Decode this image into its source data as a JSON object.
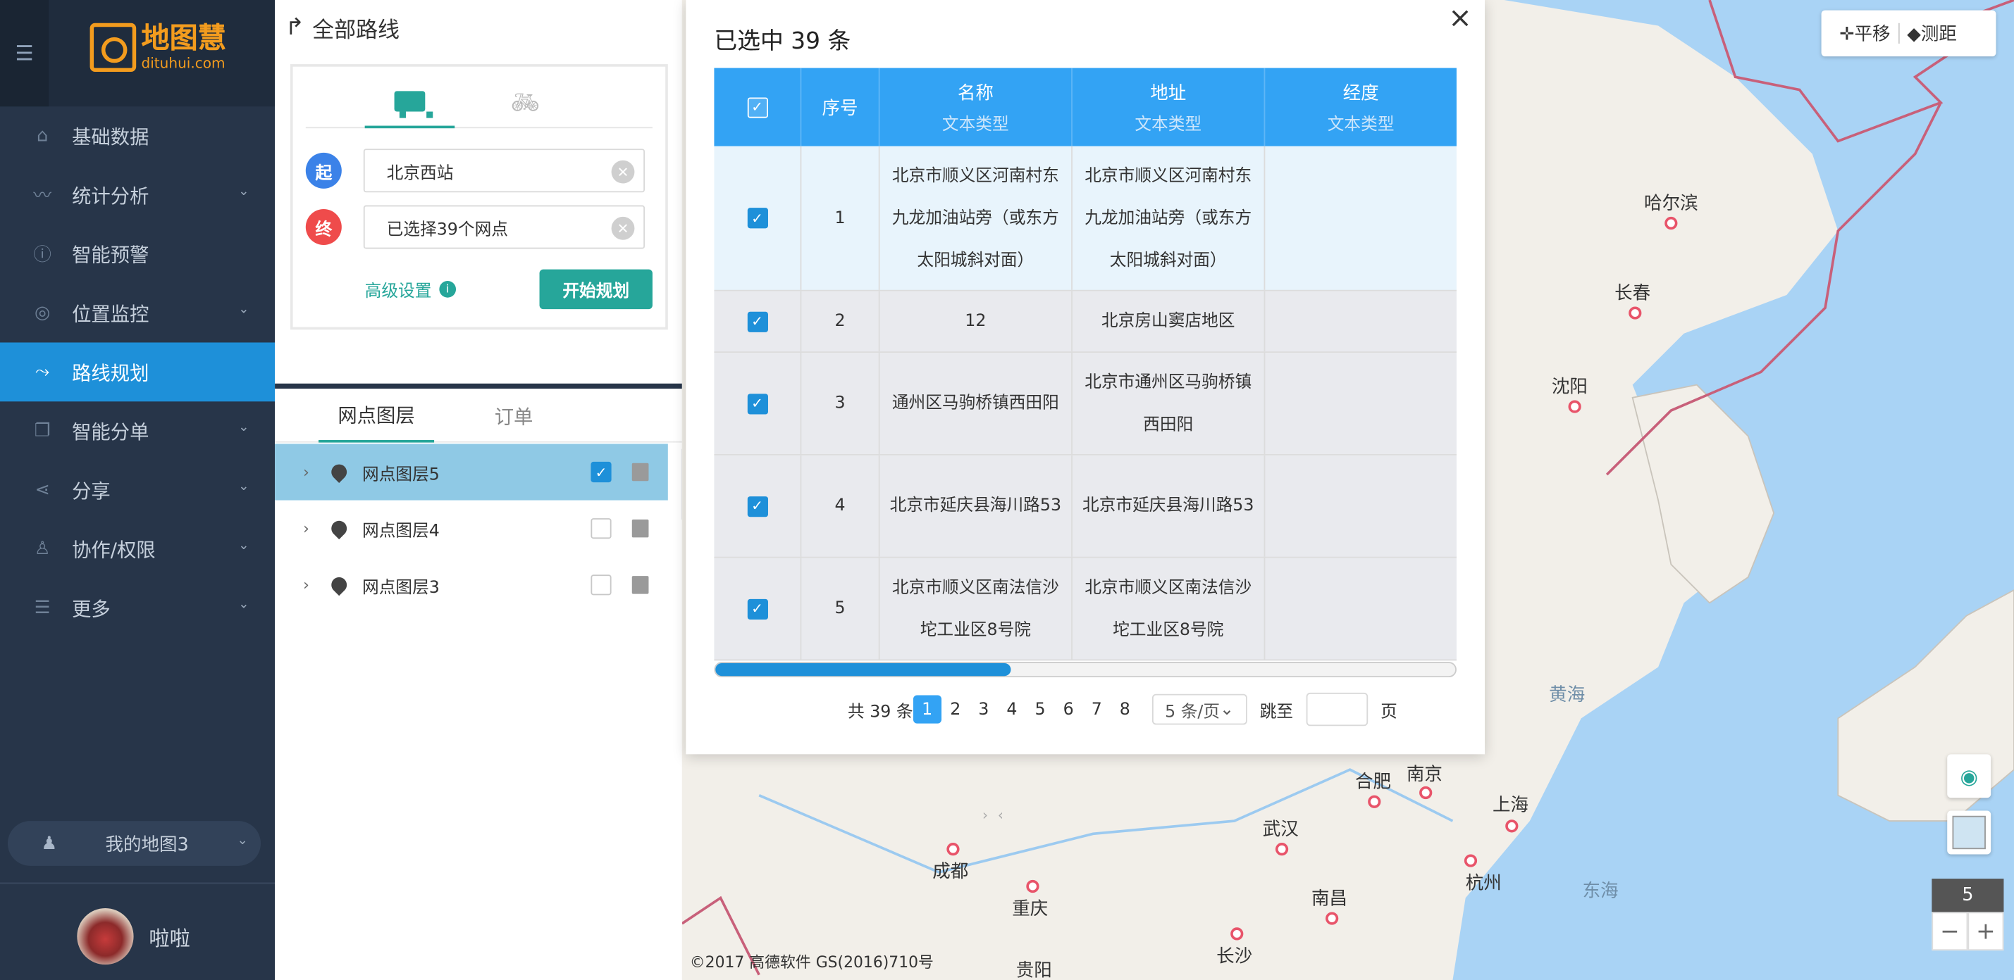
{
  "app": {
    "logo_cn": "地图慧",
    "logo_en": "dituhui.com"
  },
  "sidebar": {
    "items": [
      {
        "label": "基础数据",
        "has_chevron": false
      },
      {
        "label": "统计分析",
        "has_chevron": true
      },
      {
        "label": "智能预警",
        "has_chevron": false
      },
      {
        "label": "位置监控",
        "has_chevron": true
      },
      {
        "label": "路线规划",
        "has_chevron": false,
        "active": true
      },
      {
        "label": "智能分单",
        "has_chevron": true
      },
      {
        "label": "分享",
        "has_chevron": true
      },
      {
        "label": "协作/权限",
        "has_chevron": true
      },
      {
        "label": "更多",
        "has_chevron": true
      }
    ],
    "my_map": "我的地图3",
    "user_name": "啦啦"
  },
  "panel": {
    "title": "全部路线",
    "start_badge": "起",
    "end_badge": "终",
    "start_value": "北京西站",
    "end_value": "已选择39个网点",
    "advanced": "高级设置",
    "plan_button": "开始规划",
    "tab_layers": "网点图层",
    "tab_orders": "订单",
    "layers": [
      {
        "name": "网点图层5",
        "checked": true
      },
      {
        "name": "网点图层4",
        "checked": false
      },
      {
        "name": "网点图层3",
        "checked": false
      }
    ]
  },
  "modal": {
    "title": "已选中 39 条",
    "close": "×",
    "headers": {
      "index": "序号",
      "name": "名称",
      "address": "地址",
      "lng": "经度",
      "type": "文本类型"
    },
    "rows": [
      {
        "index": "1",
        "name": "北京市顺义区河南村东九龙加油站旁（或东方太阳城斜对面）",
        "address": "北京市顺义区河南村东九龙加油站旁（或东方太阳城斜对面）",
        "lng": ""
      },
      {
        "index": "2",
        "name": "12",
        "address": "北京房山窦店地区",
        "lng": ""
      },
      {
        "index": "3",
        "name": "通州区马驹桥镇西田阳",
        "address": "北京市通州区马驹桥镇西田阳",
        "lng": ""
      },
      {
        "index": "4",
        "name": "北京市延庆县海川路53",
        "address": "北京市延庆县海川路53",
        "lng": ""
      },
      {
        "index": "5",
        "name": "北京市顺义区南法信沙坨工业区8号院",
        "address": "北京市顺义区南法信沙坨工业区8号院",
        "lng": ""
      }
    ],
    "scroll_fraction": 0.4,
    "pager": {
      "total": "共 39 条",
      "pages": [
        "1",
        "2",
        "3",
        "4",
        "5",
        "6",
        "7",
        "8"
      ],
      "current": "1",
      "page_size": "5 条/页",
      "jump": "跳至",
      "unit": "页"
    }
  },
  "map": {
    "tool_pan": "平移",
    "tool_measure": "测距",
    "zoom_level": "5",
    "zoom_out": "−",
    "zoom_in": "+",
    "copyright": "©2017 高德软件 GS(2016)710号",
    "cities": [
      "哈尔滨",
      "长春",
      "沈阳",
      "合肥",
      "南京",
      "上海",
      "武汉",
      "杭州",
      "成都",
      "重庆",
      "南昌",
      "长沙",
      "贵阳"
    ],
    "seas": [
      "黄海",
      "东海"
    ]
  }
}
